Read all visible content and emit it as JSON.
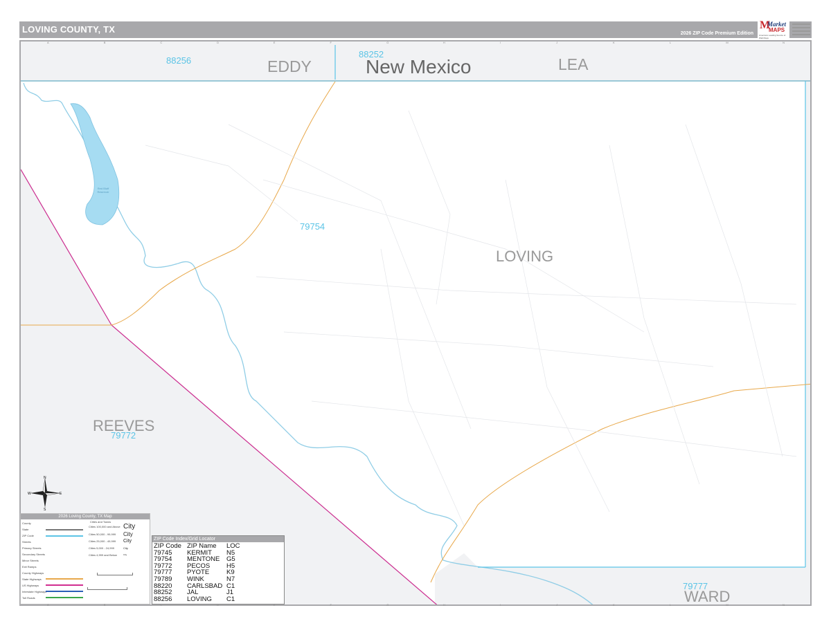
{
  "header": {
    "title": "LOVING COUNTY, TX",
    "edition": "2026 ZIP Code Premium Edition"
  },
  "logo": {
    "brand": "Market",
    "brand_sub": "MAPS",
    "tagline": "America's Leading Source of Wall Maps"
  },
  "grid_columns": [
    "A",
    "B",
    "C",
    "D",
    "E",
    "F",
    "G",
    "H",
    "I",
    "J",
    "K",
    "L",
    "M",
    "N"
  ],
  "map_labels": {
    "state": "New Mexico",
    "counties": {
      "eddy": "EDDY",
      "lea": "LEA",
      "loving": "LOVING",
      "reeves": "REEVES",
      "ward": "WARD"
    },
    "zips": {
      "z88256": "88256",
      "z88252": "88252",
      "z79754": "79754",
      "z79772": "79772",
      "z79777": "79777"
    },
    "water": "Red Bluff Reservoir"
  },
  "compass": {
    "n": "N",
    "s": "S",
    "e": "E",
    "w": "W"
  },
  "legend": {
    "title": "2026 Loving County, TX Map",
    "city_header": "Cities and Towns",
    "rows": [
      "County",
      "State",
      "ZIP Code",
      "Streets",
      "Primary Streets",
      "Secondary Streets",
      "Minor Streets",
      "Exit Ramps",
      "County Highways",
      "State Highways",
      "US Highways",
      "Interstate Highways",
      "Toll Roads"
    ],
    "cities": [
      {
        "range": "Cities 100,000 and Above",
        "sample": "City"
      },
      {
        "range": "Cities 50,000 - 99,999",
        "sample": "City"
      },
      {
        "range": "Cities 25,000 - 49,999",
        "sample": "City"
      },
      {
        "range": "Cities 5,000 - 24,999",
        "sample": "City"
      },
      {
        "range": "Cities 4,999 and Below",
        "sample": "City"
      }
    ],
    "colors": {
      "zip": "#5bc4e6",
      "state_hwy": "#e8a84a",
      "us_hwy": "#d02d8f",
      "interstate": "#2a5fb8",
      "toll": "#3aa64a",
      "water": "#a6dcf2"
    }
  },
  "zip_index": {
    "title": "ZIP Code Index/Grid Locator",
    "headers": [
      "ZIP Code",
      "ZIP Name",
      "LOC"
    ],
    "rows": [
      [
        "79745",
        "KERMIT",
        "N5"
      ],
      [
        "79754",
        "MENTONE",
        "G5"
      ],
      [
        "79772",
        "PECOS",
        "H5"
      ],
      [
        "79777",
        "PYOTE",
        "K9"
      ],
      [
        "79789",
        "WINK",
        "N7"
      ],
      [
        "88220",
        "CARLSBAD",
        "C1"
      ],
      [
        "88252",
        "JAL",
        "J1"
      ],
      [
        "88256",
        "LOVING",
        "C1"
      ]
    ]
  }
}
